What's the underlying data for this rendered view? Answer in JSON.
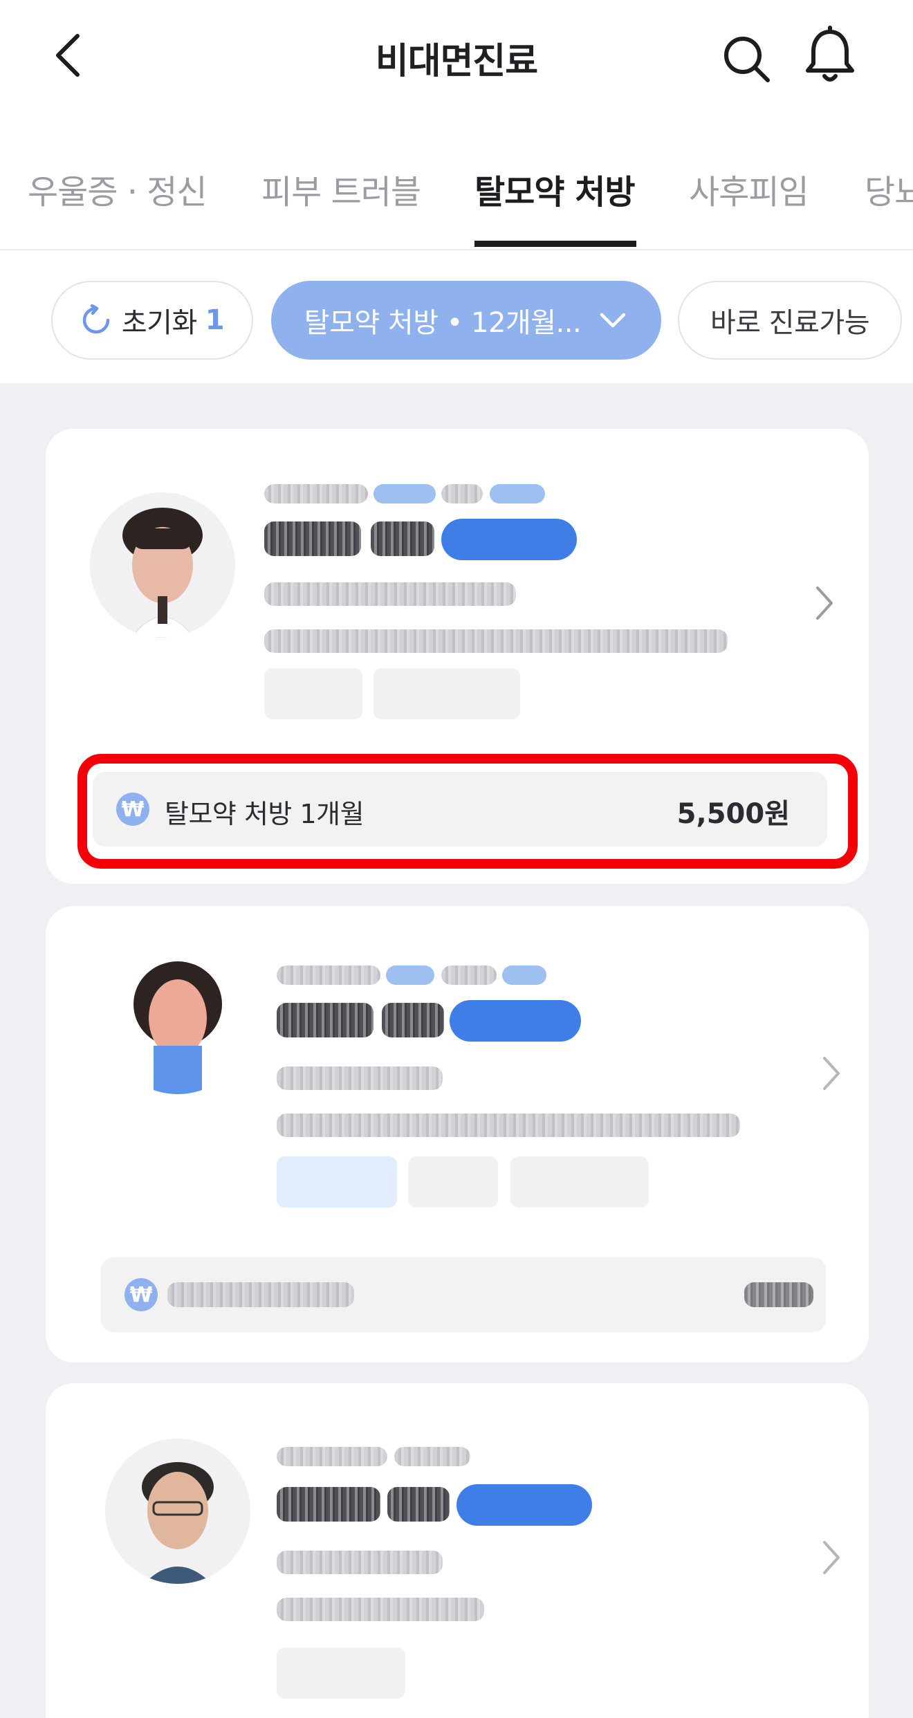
{
  "header": {
    "title": "비대면진료",
    "back_icon": "chevron-left-icon",
    "search_icon": "search-icon",
    "notification_icon": "bell-icon"
  },
  "tabs": [
    {
      "label": "우울증 · 정신",
      "active": false
    },
    {
      "label": "피부 트러블",
      "active": false
    },
    {
      "label": "탈모약 처방",
      "active": true
    },
    {
      "label": "사후피임",
      "active": false
    },
    {
      "label": "당뇨",
      "active": false
    }
  ],
  "filters": {
    "reset_label": "초기화",
    "reset_count": "1",
    "active_filter_label": "탈모약 처방 • 12개월...",
    "now_available_label": "바로 진료가능"
  },
  "cards": [
    {
      "price_label": "탈모약 처방 1개월",
      "price_value": "5,500원",
      "price_icon": "won-icon",
      "highlighted": true
    },
    {
      "price_label": "",
      "price_value": "",
      "price_icon": "won-icon",
      "highlighted": false
    },
    {
      "price_icon": "won-icon",
      "highlighted": false
    }
  ],
  "colors": {
    "accent_blue": "#8fb2ef",
    "strong_blue": "#3f7ee6",
    "highlight_red": "#f40008",
    "list_background": "#eef0f4"
  }
}
